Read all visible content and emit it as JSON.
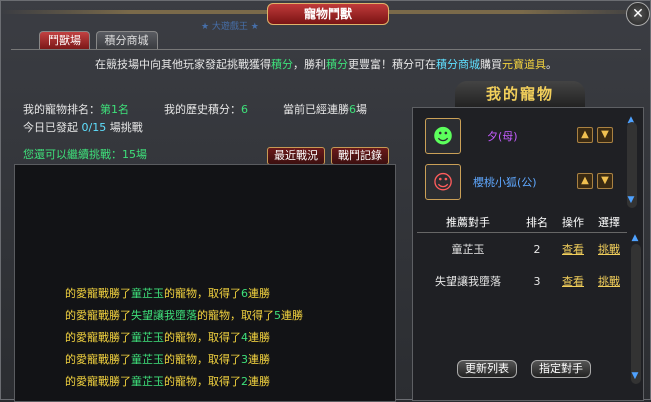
{
  "window": {
    "title": "寵物鬥獸",
    "deco_text": "★ 大遊戲王 ★"
  },
  "tabs": [
    "鬥獸場",
    "積分商城"
  ],
  "notice": {
    "p1": "在競技場中向其他玩家發起挑戰獲得",
    "p2": "積分",
    "p3": "，勝利",
    "p4": "積分",
    "p5": "更豐富！積分可在",
    "p6": "積分商城",
    "p7": "購買",
    "p8": "元寶道具",
    "p9": "。"
  },
  "stats": {
    "rank_label": "我的寵物排名：",
    "rank_value": "第1名",
    "history_label": "我的歷史積分：",
    "history_value": "6",
    "streak_label": "當前已經連勝",
    "streak_value": "6",
    "streak_unit": "場",
    "today_label": "今日已發起",
    "today_value": "0/15",
    "today_unit": "場挑戰",
    "can_label": "您還可以繼續挑戰：",
    "can_value": "15場"
  },
  "log_tabs": [
    "最近戰況",
    "戰鬥記錄"
  ],
  "log": [
    {
      "prefix": "的愛寵戰勝了",
      "name": "童芷玉",
      "mid": "的寵物，取得了",
      "num": "6",
      "suffix": "連勝"
    },
    {
      "prefix": "的愛寵戰勝了",
      "name": "失望讓我墮落",
      "mid": "的寵物，取得了",
      "num": "5",
      "suffix": "連勝"
    },
    {
      "prefix": "的愛寵戰勝了",
      "name": "童芷玉",
      "mid": "的寵物，取得了",
      "num": "4",
      "suffix": "連勝"
    },
    {
      "prefix": "的愛寵戰勝了",
      "name": "童芷玉",
      "mid": "的寵物，取得了",
      "num": "3",
      "suffix": "連勝"
    },
    {
      "prefix": "的愛寵戰勝了",
      "name": "童芷玉",
      "mid": "的寵物，取得了",
      "num": "2",
      "suffix": "連勝"
    }
  ],
  "my_pets": {
    "header": "我的寵物",
    "items": [
      {
        "name": "夕(母)",
        "color": "#c45cff",
        "icon": "goblin-pet-icon"
      },
      {
        "name": "櫻桃小狐(公)",
        "color": "#5fa8ff",
        "icon": "fox-pet-icon"
      }
    ]
  },
  "opponents": {
    "headers": [
      "推薦對手",
      "排名",
      "操作",
      "選擇"
    ],
    "rows": [
      {
        "name": "童芷玉",
        "rank": "2",
        "view": "查看",
        "challenge": "挑戰"
      },
      {
        "name": "失望讓我墮落",
        "rank": "3",
        "view": "查看",
        "challenge": "挑戰"
      }
    ]
  },
  "buttons": {
    "refresh": "更新列表",
    "choose": "指定對手"
  }
}
